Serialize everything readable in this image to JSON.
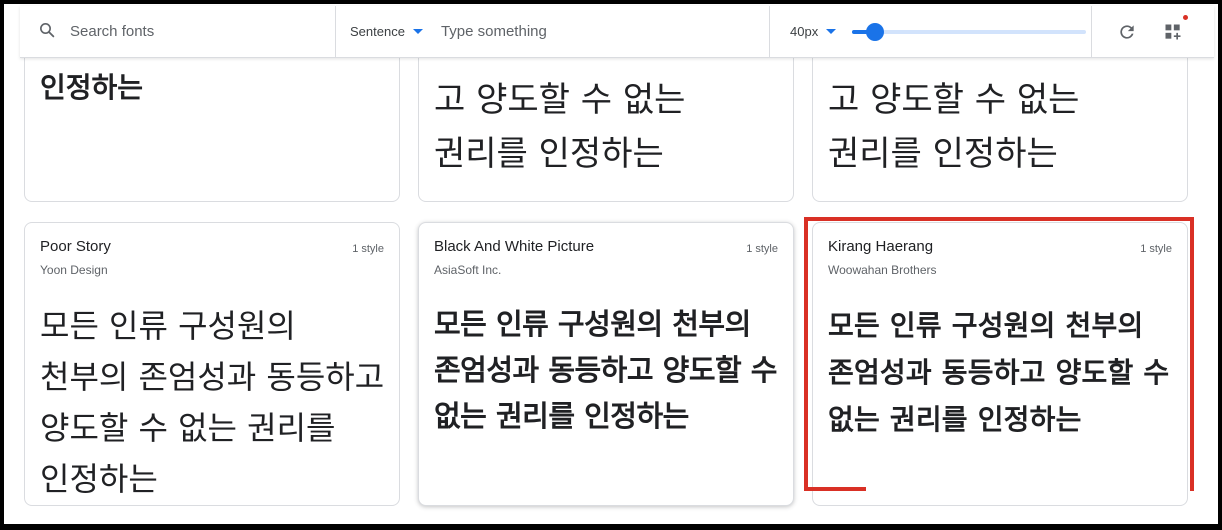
{
  "toolbar": {
    "search_placeholder": "Search fonts",
    "mode": "Sentence",
    "text_placeholder": "Type something",
    "size": "40px",
    "size_slider_fraction": 0.1,
    "icons": [
      "search-icon",
      "caret-down-icon",
      "refresh-icon",
      "grid-add-icon"
    ],
    "accent_color": "#1a73e8"
  },
  "cards_top": [
    {
      "sample": "인정하는"
    },
    {
      "sample": "고 양도할 수 없는 권리를 인정하는"
    },
    {
      "sample": "고 양도할 수 없는 권리를 인정하는"
    }
  ],
  "cards": [
    {
      "name": "Poor Story",
      "designer": "Yoon Design",
      "styles": "1 style",
      "sample": "모든 인류 구성원의 천부의 존엄성과 동등하고 양도할 수 없는 권리를 인정하는"
    },
    {
      "name": "Black And White Picture",
      "designer": "AsiaSoft Inc.",
      "styles": "1 style",
      "sample": "모든 인류 구성원의 천부의 존엄성과 동등하고 양도할 수 없는 권리를 인정하는"
    },
    {
      "name": "Kirang Haerang",
      "designer": "Woowahan Brothers",
      "styles": "1 style",
      "sample": "모든 인류 구성원의 천부의 존엄성과 동등하고 양도할 수 없는 권리를 인정하는"
    }
  ],
  "highlight_color": "#d93025"
}
